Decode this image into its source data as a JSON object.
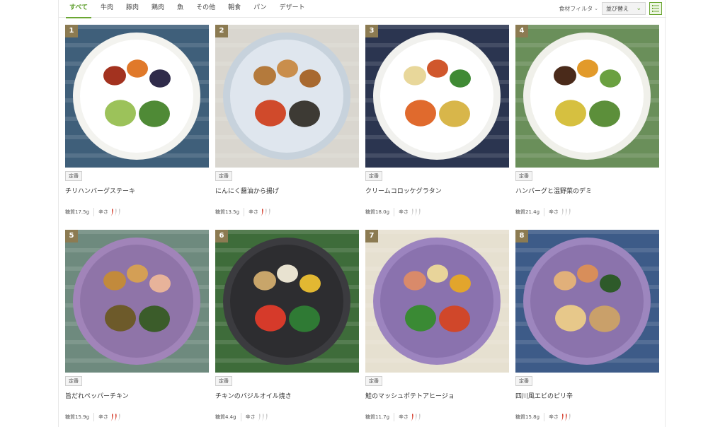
{
  "nav": {
    "tabs": [
      "すべて",
      "牛肉",
      "豚肉",
      "鶏肉",
      "魚",
      "その他",
      "朝食",
      "パン",
      "デザート"
    ],
    "active_tab": 0,
    "filter_label": "食材フィルタ",
    "sort_label": "並び替え"
  },
  "colors": {
    "accent": "#6aa632",
    "spice_on": "#d2311f",
    "spice_off": "#c9c9c9",
    "rank_bg": "#8c7b52"
  },
  "icons": {
    "filter": "chevron-down-icon",
    "sort": "chevron-down-icon",
    "view_toggle": "list-view-icon",
    "spice": "chili-pepper-icon"
  },
  "products": [
    {
      "rank": "1",
      "badge": "定番",
      "name": "チリハンバーグステーキ",
      "carbs": "糖質17.5g",
      "spice_label": "辛さ",
      "spice_level": 1
    },
    {
      "rank": "2",
      "badge": "定番",
      "name": "にんにく醤油から揚げ",
      "carbs": "糖質13.5g",
      "spice_label": "辛さ",
      "spice_level": 1
    },
    {
      "rank": "3",
      "badge": "定番",
      "name": "クリームコロッケグラタン",
      "carbs": "糖質18.0g",
      "spice_label": "辛さ",
      "spice_level": 0
    },
    {
      "rank": "4",
      "badge": "定番",
      "name": "ハンバーグと温野菜のデミ",
      "carbs": "糖質21.4g",
      "spice_label": "辛さ",
      "spice_level": 0
    },
    {
      "rank": "5",
      "badge": "定番",
      "name": "旨だれペッパーチキン",
      "carbs": "糖質15.9g",
      "spice_label": "辛さ",
      "spice_level": 2
    },
    {
      "rank": "6",
      "badge": "定番",
      "name": "チキンのバジルオイル焼き",
      "carbs": "糖質4.4g",
      "spice_label": "辛さ",
      "spice_level": 0
    },
    {
      "rank": "7",
      "badge": "定番",
      "name": "鮭のマッシュポテトアヒージョ",
      "carbs": "糖質11.7g",
      "spice_label": "辛さ",
      "spice_level": 1
    },
    {
      "rank": "8",
      "badge": "定番",
      "name": "四川風エビのピリ辛",
      "carbs": "糖質15.8g",
      "spice_label": "辛さ",
      "spice_level": 2
    }
  ]
}
